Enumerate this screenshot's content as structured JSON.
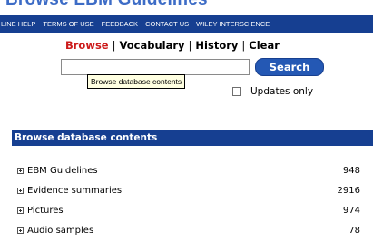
{
  "page": {
    "title": "Browse EBM Guidelines"
  },
  "topnav": {
    "links": [
      "LINE HELP",
      "TERMS OF USE",
      "FEEDBACK",
      "CONTACT US",
      "WILEY INTERSCIENCE"
    ]
  },
  "actions": {
    "browse": "Browse",
    "vocabulary": "Vocabulary",
    "history": "History",
    "clear": "Clear",
    "separator": "|"
  },
  "search": {
    "value": "",
    "button_label": "Search",
    "tooltip": "Browse database contents"
  },
  "options": {
    "updates_only_label": "Updates only",
    "updates_only_checked": false
  },
  "contents": {
    "header": "Browse database contents",
    "items": [
      {
        "label": "EBM Guidelines",
        "count": "948"
      },
      {
        "label": "Evidence summaries",
        "count": "2916"
      },
      {
        "label": "Pictures",
        "count": "974"
      },
      {
        "label": "Audio samples",
        "count": "78"
      }
    ]
  }
}
